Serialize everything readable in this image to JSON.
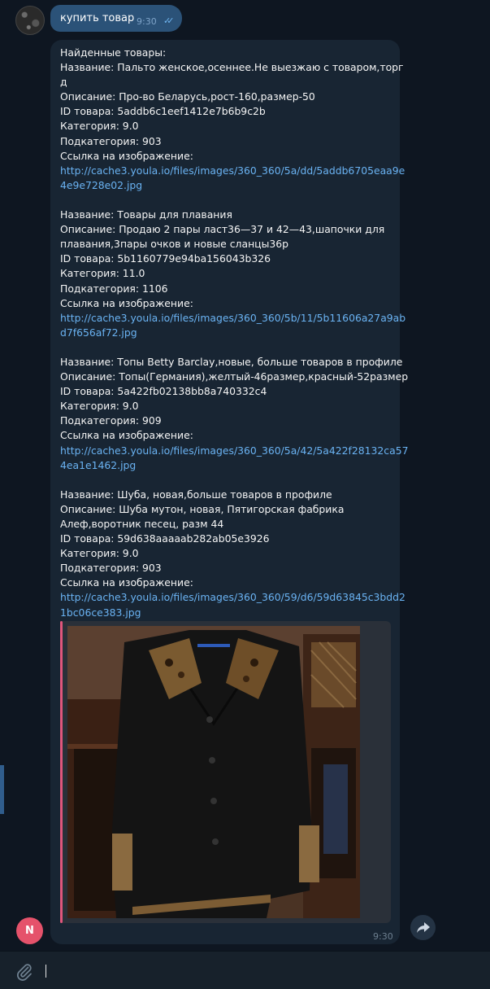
{
  "outgoing": {
    "text": "купить товар",
    "time": "9:30"
  },
  "incoming": {
    "time": "9:30",
    "lines": [
      "Найденные товары:",
      "Название: Пальто женское,осеннее.Не выезжаю с товаром,торг",
      "д",
      "Описание: Про-во Беларусь,рост-160,размер-50",
      "ID товара: 5addb6c1eef1412e7b6b9c2b",
      "Категория: 9.0",
      "Подкатегория: 903",
      "Ссылка на изображение:",
      "http://cache3.youla.io/files/images/360_360/5a/dd/5addb6705eaa9e",
      "4e9e728e02.jpg",
      "",
      "Название: Товары для плавания",
      "Описание: Продаю 2 пары ласт36—37 и 42—43,шапочки для",
      "плавания,3пары очков и новые сланцы36р",
      "ID товара: 5b1160779e94ba156043b326",
      "Категория: 11.0",
      "Подкатегория: 1106",
      "Ссылка на изображение:",
      "http://cache3.youla.io/files/images/360_360/5b/11/5b11606a27a9ab",
      "d7f656af72.jpg",
      "",
      "Название: Топы Betty Barclay,новые, больше товаров в профиле",
      "Описание: Топы(Германия),желтый-46размер,красный-52размер",
      "ID товара: 5a422fb02138bb8a740332c4",
      "Категория: 9.0",
      "Подкатегория: 909",
      "Ссылка на изображение:",
      "http://cache3.youla.io/files/images/360_360/5a/42/5a422f28132ca57",
      "4ea1e1462.jpg",
      "",
      "Название: Шуба, новая,больше товаров в профиле",
      "Описание: Шуба мутон, новая, Пятигорская фабрика",
      "Алеф,воротник песец, разм 44",
      "ID товара: 59d638aaaaab282ab05e3926",
      "Категория: 9.0",
      "Подкатегория: 903",
      "Ссылка на изображение:",
      "http://cache3.youla.io/files/images/360_360/59/d6/59d63845c3bdd2",
      "1bc06ce383.jpg"
    ]
  },
  "bot_avatar": {
    "letter": "N",
    "color": "#e5526b"
  },
  "composer": {
    "placeholder": ""
  },
  "colors": {
    "background": "#0e1621",
    "incoming_bubble": "#182533",
    "outgoing_bubble": "#2b5278",
    "link": "#6ab3f3",
    "accent_bar": "#e0567c"
  },
  "icons": [
    "paperclip-icon",
    "share-arrow-icon",
    "double-check-icon"
  ]
}
